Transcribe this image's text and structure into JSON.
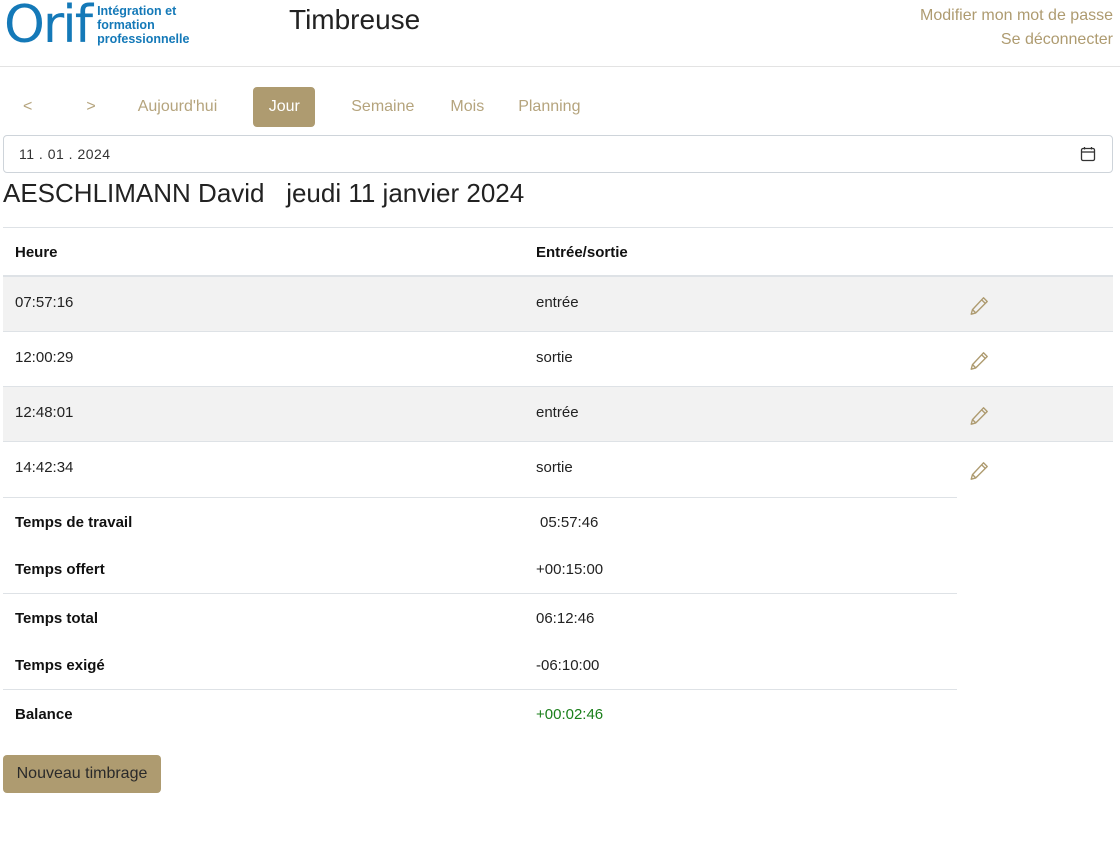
{
  "header": {
    "logo_word": "Orif",
    "logo_tagline": [
      "Intégration et",
      "formation",
      "professionnelle"
    ],
    "app_title": "Timbreuse",
    "links": {
      "change_password": "Modifier mon mot de passe",
      "logout": "Se déconnecter"
    }
  },
  "nav": {
    "prev": "<",
    "next": ">",
    "today": "Aujourd'hui",
    "day": "Jour",
    "week": "Semaine",
    "month": "Mois",
    "planning": "Planning",
    "active": "Jour"
  },
  "date_input": {
    "value": "11 . 01 . 2024"
  },
  "heading": {
    "name": "AESCHLIMANN David",
    "date": "jeudi 11 janvier 2024"
  },
  "table": {
    "columns": [
      "Heure",
      "Entrée/sortie"
    ],
    "rows": [
      {
        "time": "07:57:16",
        "type": "entrée"
      },
      {
        "time": "12:00:29",
        "type": "sortie"
      },
      {
        "time": "12:48:01",
        "type": "entrée"
      },
      {
        "time": "14:42:34",
        "type": "sortie"
      }
    ]
  },
  "summary": {
    "work_time_label": "Temps de travail",
    "work_time_value": "05:57:46",
    "offered_label": "Temps offert",
    "offered_value": "+00:15:00",
    "total_label": "Temps total",
    "total_value": "06:12:46",
    "required_label": "Temps exigé",
    "required_value": "-06:10:00",
    "balance_label": "Balance",
    "balance_value": "+00:02:46"
  },
  "actions": {
    "new_clocking": "Nouveau timbrage"
  },
  "colors": {
    "brand_blue": "#1479b8",
    "accent_gold": "#ae9b70",
    "balance_green": "#1a7f1a"
  },
  "icons": {
    "calendar": "calendar-icon",
    "edit": "pencil-icon"
  }
}
